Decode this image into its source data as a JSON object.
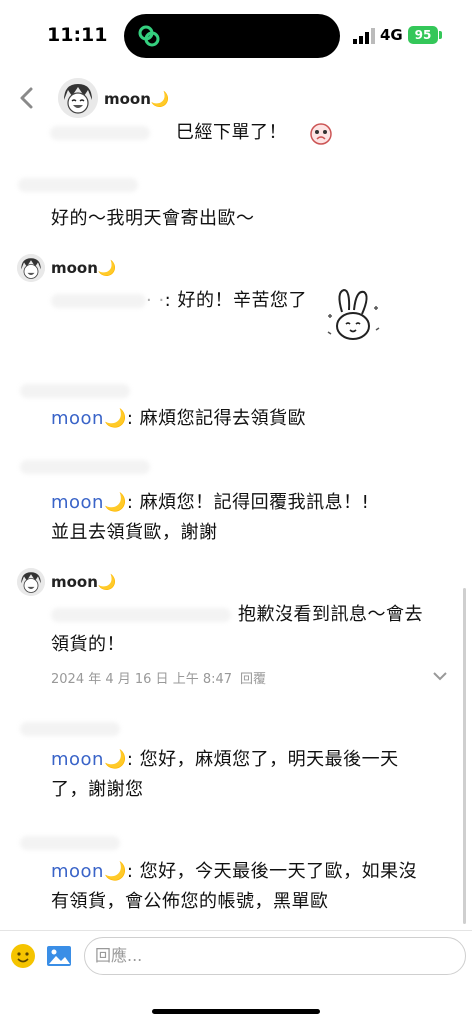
{
  "status_bar": {
    "time": "11:11",
    "network": "4G",
    "battery": "95"
  },
  "header": {
    "username": "moon",
    "moon_emoji": "🌙"
  },
  "messages": {
    "m1": "巳經下單了！",
    "m2": "好的～我明天會寄出歐～",
    "m3_user": "moon",
    "m3_text": ": 好的！辛苦您了",
    "m4_mention": "moon",
    "m4_text": ": 麻煩您記得去領貨歐",
    "m5_mention": "moon",
    "m5_text_line1": ": 麻煩您！記得回覆我訊息！!",
    "m5_text_line2": "並且去領貨歐，謝謝",
    "m6_user": "moon",
    "m6_text_line1": "抱歉沒看到訊息～會去",
    "m6_text_line2": "領貨的！",
    "m6_time": "2024 年 4 月 16 日 上午 8:47",
    "m6_reply": "回覆",
    "m7_mention": "moon",
    "m7_text_line1": ": 您好，麻煩您了，明天最後一天",
    "m7_text_line2": "了，謝謝您",
    "m8_mention": "moon",
    "m8_text_line1": ": 您好，今天最後一天了歐，如果沒",
    "m8_text_line2": "有領貨，會公佈您的帳號，黑單歐"
  },
  "composer": {
    "placeholder": "回應..."
  },
  "icons": [
    "back-icon",
    "emoji-icon",
    "image-icon",
    "chevron-down-icon"
  ],
  "colors": {
    "mention": "#3a64c8",
    "battery": "#34c759"
  }
}
